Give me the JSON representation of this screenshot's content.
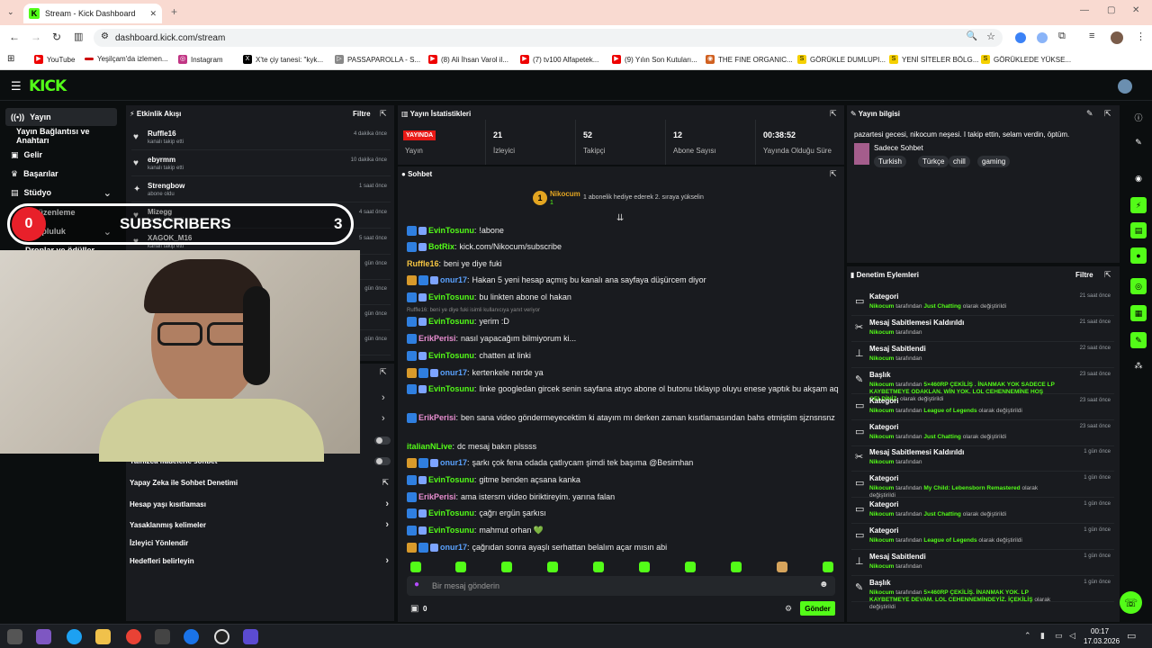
{
  "browser": {
    "tab_title": "Stream - Kick Dashboard",
    "url": "dashboard.kick.com/stream",
    "bookmarks": [
      "YouTube",
      "Yeşilçam'da izlemen...",
      "Instagram",
      "X'te çiy tanesi: \"kyk...",
      "PASSAPAROLLA - S...",
      "(8) Ali İhsan Varol il...",
      "(7) tv100 Alfapetek...",
      "(9) Yılın Son Kutuları...",
      "THE FINE ORGANIC...",
      "GÖRÜKLE DUMLUPI...",
      "YENİ SİTELER BÖLG...",
      "GÖRÜKLEDE YÜKSE..."
    ]
  },
  "sidebar": {
    "items": [
      {
        "label": "Yayın"
      },
      {
        "label": "Yayın Bağlantısı ve Anahtarı"
      },
      {
        "label": "Gelir"
      },
      {
        "label": "Başarılar"
      },
      {
        "label": "Stüdyo"
      },
      {
        "label": "Düzenleme"
      },
      {
        "label": "Topluluk"
      },
      {
        "label": "Droplar ve ödüller"
      }
    ]
  },
  "events": {
    "title": "Etkinlik Akışı",
    "filter": "Filtre",
    "items": [
      {
        "name": "Ruffle16",
        "sub": "kanalı takip etti",
        "time": "4 dakika önce"
      },
      {
        "name": "ebyrmm",
        "sub": "kanalı takip etti",
        "time": "10 dakika önce"
      },
      {
        "name": "Strengbow",
        "sub": "abone oldu",
        "time": "1 saat önce"
      },
      {
        "name": "Mizegg",
        "sub": "kanalı takip etti",
        "time": "4 saat önce"
      },
      {
        "name": "XAGOK_M16",
        "sub": "kanalı takip etti",
        "time": "5 saat önce"
      },
      {
        "name": "",
        "sub": "",
        "time": "gün önce"
      },
      {
        "name": "",
        "sub": "",
        "time": "gün önce"
      },
      {
        "name": "",
        "sub": "",
        "time": "gün önce"
      },
      {
        "name": "",
        "sub": "",
        "time": "gün önce"
      }
    ]
  },
  "overlay": {
    "left": "0",
    "label": "SUBSCRIBERS",
    "right": "3"
  },
  "settings": {
    "items": [
      "Yalnızca ifadelerle sohbet",
      "Yapay Zeka ile Sohbet Denetimi",
      "Hesap yaşı kısıtlaması",
      "Yasaklanmış kelimeler",
      "İzleyici Yönlendir",
      "Hedefleri belirleyin"
    ]
  },
  "stats": {
    "title": "Yayın İstatistikleri",
    "live_badge": "YAYINDA",
    "live_label": "Yayın",
    "items": [
      {
        "value": "21",
        "label": "İzleyici"
      },
      {
        "value": "52",
        "label": "Takipçi"
      },
      {
        "value": "12",
        "label": "Abone Sayısı"
      },
      {
        "value": "00:38:52",
        "label": "Yayında Olduğu Süre"
      }
    ]
  },
  "chat": {
    "title": "Sohbet",
    "pinned_user": "Nikocum",
    "pinned_count": "1",
    "pinned_text": "1 abonelik hediye ederek 2. sıraya yükselin",
    "reply_hint": "Ruffle16: beni ye diye fuki isimli kullanıcıya yanıt veriyor",
    "messages": [
      {
        "user": "EvinTosunu",
        "color": "#53fc18",
        "badges": [
          "mod",
          "sub"
        ],
        "text": "!abone"
      },
      {
        "user": "BotRix",
        "color": "#53fc18",
        "badges": [
          "mod",
          "sub"
        ],
        "text": "kick.com/Nikocum/subscribe"
      },
      {
        "user": "Ruffle16",
        "color": "#f5c542",
        "badges": [],
        "text": "beni ye diye fuki"
      },
      {
        "user": "onur17",
        "color": "#5aa2ff",
        "badges": [
          "vip",
          "mod",
          "sub"
        ],
        "text": "Hakan 5 yeni hesap açmış bu kanalı ana sayfaya düşürcem diyor"
      },
      {
        "user": "EvinTosunu",
        "color": "#53fc18",
        "badges": [
          "mod",
          "sub"
        ],
        "text": "bu linkten abone ol hakan"
      },
      {
        "user": "EvinTosunu",
        "color": "#53fc18",
        "badges": [
          "mod",
          "sub"
        ],
        "text": "yerim :D"
      },
      {
        "user": "ErikPerisi",
        "color": "#e88ed0",
        "badges": [
          "mod"
        ],
        "text": "nasıl yapacağım bilmiyorum ki..."
      },
      {
        "user": "EvinTosunu",
        "color": "#53fc18",
        "badges": [
          "mod",
          "sub"
        ],
        "text": "chatten at linki"
      },
      {
        "user": "onur17",
        "color": "#5aa2ff",
        "badges": [
          "vip",
          "mod",
          "sub"
        ],
        "text": "kertenkele nerde ya"
      },
      {
        "user": "EvinTosunu",
        "color": "#53fc18",
        "badges": [
          "mod",
          "sub"
        ],
        "text": "linke googledan gircek senin sayfana atıyo abone ol butonu tıklayıp oluyu enese yaptık bu akşam aq"
      },
      {
        "user": "ErikPerisi",
        "color": "#e88ed0",
        "badges": [
          "mod"
        ],
        "text": "ben sana video göndermeyecektim ki atayım mı derken zaman kısıtlamasından bahs etmiştim sjznsnsnz"
      },
      {
        "user": "italianNLive",
        "color": "#53fc18",
        "badges": [],
        "text": "dc mesaj bakın plssss"
      },
      {
        "user": "onur17",
        "color": "#5aa2ff",
        "badges": [
          "vip",
          "mod",
          "sub"
        ],
        "text": "şarkı çok fena odada çatlıycam şimdi tek başıma @Besimhan"
      },
      {
        "user": "EvinTosunu",
        "color": "#53fc18",
        "badges": [
          "mod",
          "sub"
        ],
        "text": "gitme benden açsana kanka"
      },
      {
        "user": "ErikPerisi",
        "color": "#e88ed0",
        "badges": [
          "mod"
        ],
        "text": "ama istersrn video biriktireyim. yarına falan"
      },
      {
        "user": "EvinTosunu",
        "color": "#53fc18",
        "badges": [
          "mod",
          "sub"
        ],
        "text": "çağrı ergün şarkısı"
      },
      {
        "user": "EvinTosunu",
        "color": "#53fc18",
        "badges": [
          "mod",
          "sub"
        ],
        "text": "mahmut orhan 💚"
      },
      {
        "user": "onur17",
        "color": "#5aa2ff",
        "badges": [
          "vip",
          "mod",
          "sub"
        ],
        "text": "çağrıdan sonra ayaşlı serhattan belalım açar mısın abi"
      }
    ],
    "placeholder": "Bir mesaj gönderin",
    "points": "0",
    "send": "Gönder"
  },
  "info": {
    "title": "Yayın bilgisi",
    "stream_title": "pazartesi gecesi, nikocum neşesi. I takip ettin, selam verdin, öptüm.",
    "category": "Sadece Sohbet",
    "tags": [
      "Turkish",
      "Türkçe",
      "chill",
      "gaming"
    ]
  },
  "mod": {
    "title": "Denetim Eylemleri",
    "filter": "Filtre",
    "items": [
      {
        "title": "Kategori",
        "by": "Nikocum",
        "pre": "tarafından",
        "val": "Just Chatting",
        "post": "olarak değiştirildi",
        "time": "21 saat önce"
      },
      {
        "title": "Mesaj Sabitlemesi Kaldırıldı",
        "by": "Nikocum",
        "pre": "tarafından",
        "val": "",
        "post": "",
        "time": "21 saat önce"
      },
      {
        "title": "Mesaj Sabitlendi",
        "by": "Nikocum",
        "pre": "tarafından",
        "val": "",
        "post": "",
        "time": "22 saat önce"
      },
      {
        "title": "Başlık",
        "by": "Nikocum",
        "pre": "tarafından",
        "val": "5×460RP ÇEKİLİŞ . İNANMAK YOK SADECE LP KAYBETMEYE ODAKLAN. WİN YOK. LOL CEHENNEMİNE HOŞ GELDİNİZ.",
        "post": "olarak değiştirildi",
        "time": "23 saat önce"
      },
      {
        "title": "Kategori",
        "by": "Nikocum",
        "pre": "tarafından",
        "val": "League of Legends",
        "post": "olarak değiştirildi",
        "time": "23 saat önce"
      },
      {
        "title": "Kategori",
        "by": "Nikocum",
        "pre": "tarafından",
        "val": "Just Chatting",
        "post": "olarak değiştirildi",
        "time": "23 saat önce"
      },
      {
        "title": "Mesaj Sabitlemesi Kaldırıldı",
        "by": "Nikocum",
        "pre": "tarafından",
        "val": "",
        "post": "",
        "time": "1 gün önce"
      },
      {
        "title": "Kategori",
        "by": "Nikocum",
        "pre": "tarafından",
        "val": "My Child: Lebensborn Remastered",
        "post": "olarak değiştirildi",
        "time": "1 gün önce"
      },
      {
        "title": "Kategori",
        "by": "Nikocum",
        "pre": "tarafından",
        "val": "Just Chatting",
        "post": "olarak değiştirildi",
        "time": "1 gün önce"
      },
      {
        "title": "Kategori",
        "by": "Nikocum",
        "pre": "tarafından",
        "val": "League of Legends",
        "post": "olarak değiştirildi",
        "time": "1 gün önce"
      },
      {
        "title": "Mesaj Sabitlendi",
        "by": "Nikocum",
        "pre": "tarafından",
        "val": "",
        "post": "",
        "time": "1 gün önce"
      },
      {
        "title": "Başlık",
        "by": "Nikocum",
        "pre": "tarafından",
        "val": "5×460RP ÇEKİLİŞ. İNANMAK YOK. LP KAYBETMEYE DEVAM. LOL CEHENNEMİNDEYİZ. İÇEKİLİŞ",
        "post": "olarak değiştirildi",
        "time": "1 gün önce"
      }
    ]
  },
  "taskbar": {
    "time": "00:17",
    "date": "17.03.2026"
  },
  "colors": {
    "accent": "#53fc18",
    "bg": "#0b0e0f",
    "panel": "#191b1f",
    "live": "#e91916"
  }
}
